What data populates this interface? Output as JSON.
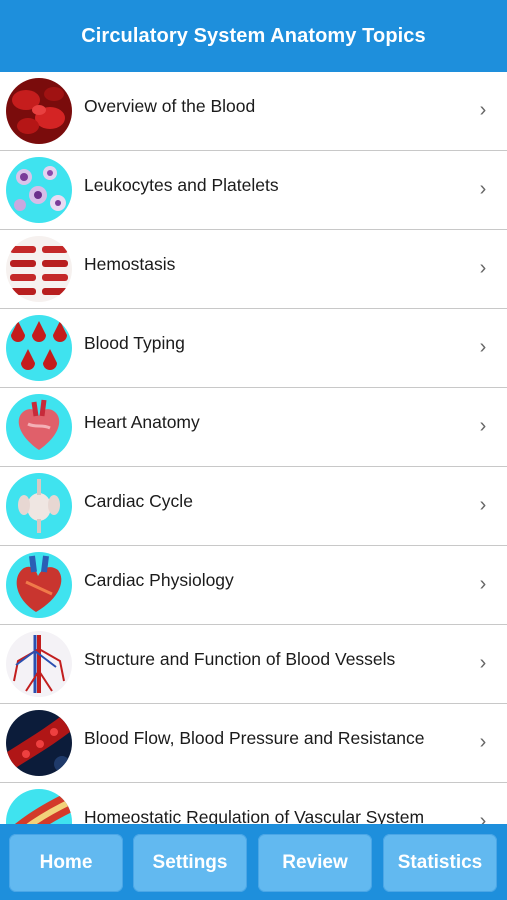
{
  "header": {
    "title": "Circulatory System Anatomy Topics"
  },
  "topics": [
    {
      "label": "Overview of the Blood",
      "icon": "red-blood-cells-icon"
    },
    {
      "label": "Leukocytes and Platelets",
      "icon": "leukocytes-icon"
    },
    {
      "label": "Hemostasis",
      "icon": "hemostasis-icon"
    },
    {
      "label": "Blood Typing",
      "icon": "blood-type-drops-icon"
    },
    {
      "label": "Heart Anatomy",
      "icon": "heart-anatomy-icon"
    },
    {
      "label": "Cardiac Cycle",
      "icon": "cardiac-cycle-icon"
    },
    {
      "label": "Cardiac Physiology",
      "icon": "cardiac-physiology-icon"
    },
    {
      "label": "Structure and Function of Blood Vessels",
      "icon": "blood-vessels-icon"
    },
    {
      "label": "Blood Flow, Blood Pressure and Resistance",
      "icon": "blood-flow-icon"
    },
    {
      "label": "Homeostatic Regulation of Vascular System",
      "icon": "vascular-regulation-icon"
    }
  ],
  "chevron": "›",
  "tabs": [
    {
      "label": "Home"
    },
    {
      "label": "Settings"
    },
    {
      "label": "Review"
    },
    {
      "label": "Statistics"
    }
  ],
  "colors": {
    "header": "#1e8fdc",
    "tab": "#62b9f0"
  }
}
